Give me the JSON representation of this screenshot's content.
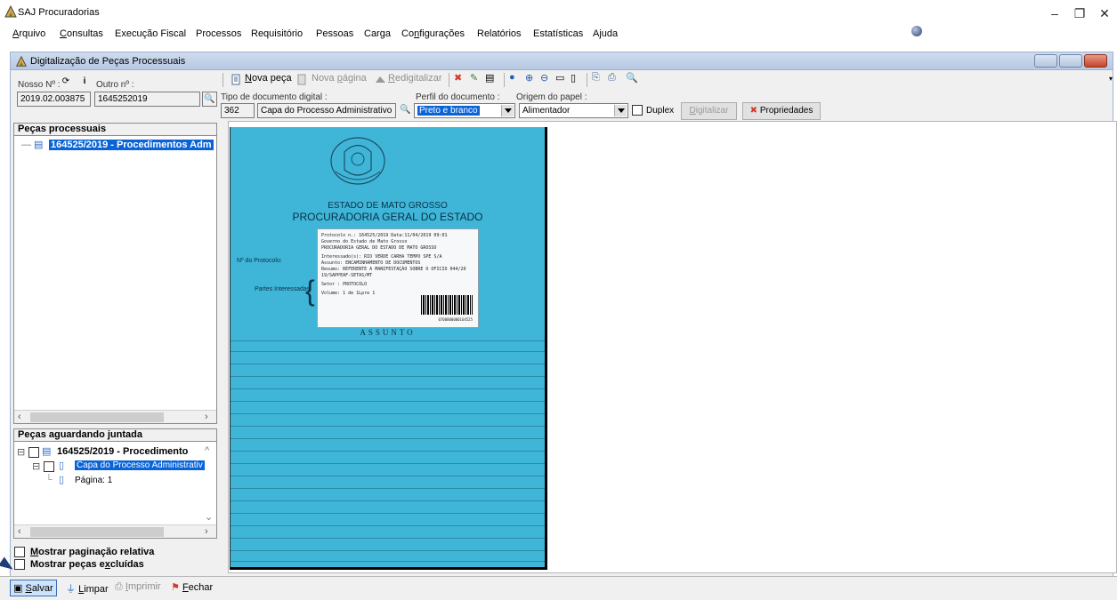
{
  "app": {
    "title": "SAJ Procuradorias"
  },
  "menu": [
    "Arquivo",
    "Consultas",
    "Execução Fiscal",
    "Processos",
    "Requisitório",
    "Pessoas",
    "Carga",
    "Configurações",
    "Relatórios",
    "Estatísticas",
    "Ajuda"
  ],
  "window": {
    "title": "Digitalização de Peças Processuais"
  },
  "fields": {
    "nosso_label": "Nosso Nº :",
    "nosso_value": "2019.02.003875",
    "outro_label": "Outro nº :",
    "outro_value": "1645252019",
    "tipo_label": "Tipo de documento digital :",
    "tipo_code": "362",
    "tipo_value": "Capa do Processo Administrativo",
    "perfil_label": "Perfil do documento :",
    "perfil_value": "Preto e branco",
    "origem_label": "Origem do papel :",
    "origem_value": "Alimentador",
    "duplex_label": "Duplex",
    "digitalizar_label": "Digitalizar",
    "propriedades_label": "Propriedades"
  },
  "toolbar": {
    "nova_peca": "Nova peça",
    "nova_pagina": "Nova página",
    "redigitalizar": "Redigitalizar"
  },
  "pecas_processuais": {
    "header": "Peças processuais",
    "node": "164525/2019 - Procedimentos Adm"
  },
  "pecas_aguardando": {
    "header": "Peças aguardando juntada",
    "node": "164525/2019 - Procedimento",
    "child": "Capa do Processo Administrativ",
    "page": "Página: 1"
  },
  "options": {
    "paginacao": "Mostrar paginação relativa",
    "excluidas": "Mostrar peças excluídas"
  },
  "scan": {
    "state": "ESTADO DE MATO GROSSO",
    "office": "PROCURADORIA GERAL DO ESTADO",
    "protocolo_label": "Nº do Protocolo:",
    "partes_label": "Partes Interessadas:",
    "assunto": "ASSUNTO",
    "sticker": {
      "line1": "Protocolo n.: 164525/2019      Data:11/04/2019 09:01",
      "line2": "Governo do Estado de Mato Grosso",
      "line3": "PROCURADORIA GERAL DO ESTADO DE MATO GROSSO",
      "line4": "Interessado(s): RIO VERDE CARHA TEMPO SPE S/A",
      "line5": "Assunto: ENCAMINHAMENTO DE DOCUMENTOS",
      "line6": "Resumo: REFERENTE A MANIFESTAÇÃO SOBRE O OFICIO 044/20",
      "line7": "19/SAPPEAF-SETAS/MT",
      "line8": "Setor          : PROTOCOLO",
      "line9": "Volume: 1 de 1Lpre 1",
      "barcode_text": "0700000000164525"
    }
  },
  "bottom": {
    "salvar": "Salvar",
    "limpar": "Limpar",
    "imprimir": "Imprimir",
    "fechar": "Fechar"
  }
}
